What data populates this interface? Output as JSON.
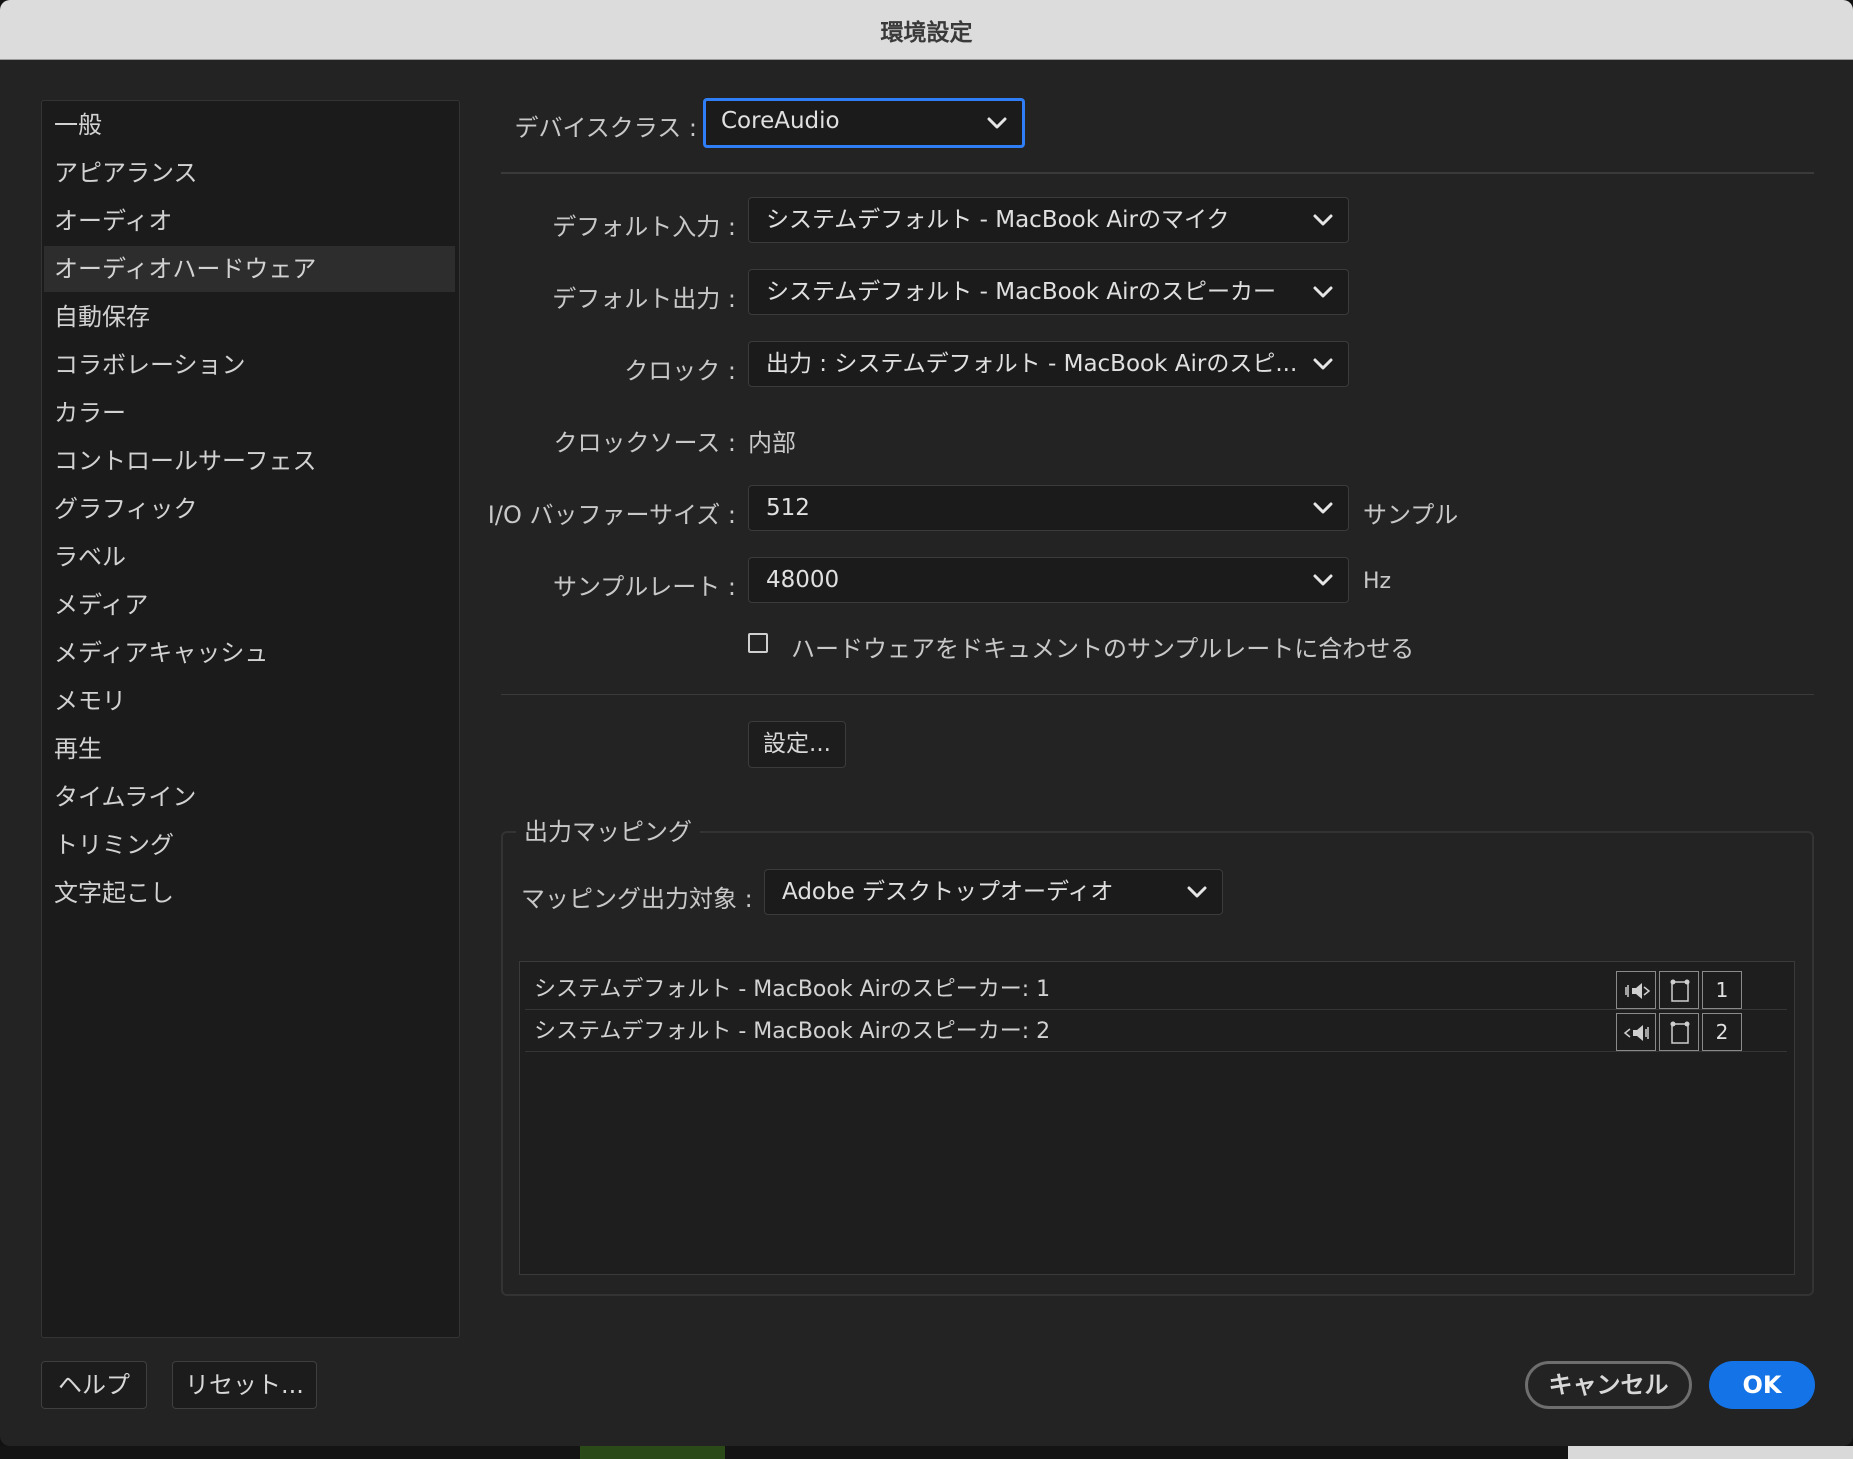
{
  "window": {
    "title": "環境設定"
  },
  "sidebar": {
    "items": [
      {
        "label": "一般"
      },
      {
        "label": "アピアランス"
      },
      {
        "label": "オーディオ"
      },
      {
        "label": "オーディオハードウェア",
        "selected": true
      },
      {
        "label": "自動保存"
      },
      {
        "label": "コラボレーション"
      },
      {
        "label": "カラー"
      },
      {
        "label": "コントロールサーフェス"
      },
      {
        "label": "グラフィック"
      },
      {
        "label": "ラベル"
      },
      {
        "label": "メディア"
      },
      {
        "label": "メディアキャッシュ"
      },
      {
        "label": "メモリ"
      },
      {
        "label": "再生"
      },
      {
        "label": "タイムライン"
      },
      {
        "label": "トリミング"
      },
      {
        "label": "文字起こし"
      }
    ]
  },
  "form": {
    "device_class": {
      "label": "デバイスクラス :",
      "value": "CoreAudio"
    },
    "default_input": {
      "label": "デフォルト入力 :",
      "value": "システムデフォルト - MacBook Airのマイク"
    },
    "default_output": {
      "label": "デフォルト出力 :",
      "value": "システムデフォルト - MacBook Airのスピーカー"
    },
    "clock": {
      "label": "クロック :",
      "value": "出力 : システムデフォルト - MacBook Airのスピ..."
    },
    "clock_source": {
      "label": "クロックソース :",
      "value": "内部"
    },
    "io_buffer": {
      "label": "I/O バッファーサイズ :",
      "value": "512",
      "unit": "サンプル"
    },
    "sample_rate": {
      "label": "サンプルレート :",
      "value": "48000",
      "unit": "Hz"
    },
    "match_rate_checkbox": {
      "label": "ハードウェアをドキュメントのサンプルレートに合わせる",
      "checked": false
    },
    "settings_button": "設定..."
  },
  "output_mapping": {
    "legend": "出力マッピング",
    "target_label": "マッピング出力対象 :",
    "target_value": "Adobe デスクトップオーディオ",
    "rows": [
      {
        "name": "システムデフォルト - MacBook Airのスピーカー: 1",
        "channel": "1",
        "speaker_icon": "speaker-left-icon",
        "device_icon": "speaker-device-icon"
      },
      {
        "name": "システムデフォルト - MacBook Airのスピーカー: 2",
        "channel": "2",
        "speaker_icon": "speaker-right-icon",
        "device_icon": "speaker-device-icon"
      }
    ]
  },
  "footer": {
    "help": "ヘルプ",
    "reset": "リセット...",
    "cancel": "キャンセル",
    "ok": "OK"
  },
  "colors": {
    "accent": "#1473e6",
    "focus_ring": "#2f7ef6",
    "background": "#232323",
    "sidebar": "#1b1b1b"
  }
}
